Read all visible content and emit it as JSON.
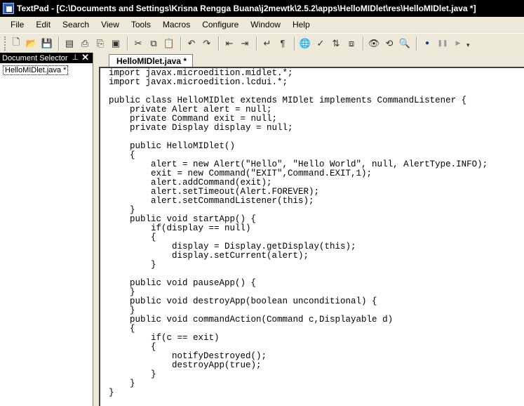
{
  "window": {
    "title": "TextPad - [C:\\Documents and Settings\\Krisna Rengga Buana\\j2mewtk\\2.5.2\\apps\\HelloMIDlet\\res\\HelloMIDlet.java *]"
  },
  "menu": [
    "File",
    "Edit",
    "Search",
    "View",
    "Tools",
    "Macros",
    "Configure",
    "Window",
    "Help"
  ],
  "toolbar": {
    "buttons": [
      {
        "name": "new-file-icon",
        "glyph": "🗋"
      },
      {
        "name": "open-icon",
        "glyph": "📂"
      },
      {
        "name": "save-icon",
        "glyph": "💾"
      },
      {
        "name": "save-all-icon",
        "glyph": "▤"
      },
      {
        "name": "print-icon",
        "glyph": "⎙"
      },
      {
        "name": "print-preview-icon",
        "glyph": "⎘"
      },
      {
        "name": "manage-files-icon",
        "glyph": "▣"
      },
      {
        "name": "cut-icon",
        "glyph": "✂"
      },
      {
        "name": "copy-icon",
        "glyph": "⧉"
      },
      {
        "name": "paste-icon",
        "glyph": "📋"
      },
      {
        "name": "undo-icon",
        "glyph": "↶"
      },
      {
        "name": "redo-icon",
        "glyph": "↷"
      },
      {
        "name": "decrease-indent-icon",
        "glyph": "⇤"
      },
      {
        "name": "increase-indent-icon",
        "glyph": "⇥"
      },
      {
        "name": "word-wrap-icon",
        "glyph": "↵"
      },
      {
        "name": "visible-spaces-icon",
        "glyph": "¶"
      },
      {
        "name": "web-browser-icon",
        "glyph": "🌐"
      },
      {
        "name": "spelling-icon",
        "glyph": "✓"
      },
      {
        "name": "sort-icon",
        "glyph": "⇅"
      },
      {
        "name": "compare-icon",
        "glyph": "⧈"
      },
      {
        "name": "find-icon",
        "glyph": "👁"
      },
      {
        "name": "replace-icon",
        "glyph": "⟲"
      },
      {
        "name": "find-in-files-icon",
        "glyph": "🔍"
      },
      {
        "name": "record-macro-icon",
        "glyph": "●"
      },
      {
        "name": "pause-macro-icon",
        "glyph": "❚❚"
      },
      {
        "name": "play-macro-icon",
        "glyph": "▶"
      }
    ],
    "overflow_glyph": "▾"
  },
  "document_selector": {
    "title": "Document Selector",
    "pin_glyph": "⊥",
    "close_glyph": "✕",
    "items": [
      "HelloMIDlet.java *"
    ]
  },
  "editor": {
    "tab_label": "HelloMIDlet.java *",
    "lines": [
      "import javax.microedition.midlet.*;",
      "import javax.microedition.lcdui.*;",
      "",
      "public class HelloMIDlet extends MIDlet implements CommandListener {",
      "    private Alert alert = null;",
      "    private Command exit = null;",
      "    private Display display = null;",
      "",
      "    public HelloMIDlet()",
      "    {",
      "        alert = new Alert(\"Hello\", \"Hello World\", null, AlertType.INFO);",
      "        exit = new Command(\"EXIT\",Command.EXIT,1);",
      "        alert.addCommand(exit);",
      "        alert.setTimeout(Alert.FOREVER);",
      "        alert.setCommandListener(this);",
      "    }",
      "    public void startApp() {",
      "        if(display == null)",
      "        {",
      "            display = Display.getDisplay(this);",
      "            display.setCurrent(alert);",
      "        }",
      "",
      "    public void pauseApp() {",
      "    }",
      "    public void destroyApp(boolean unconditional) {",
      "    }",
      "    public void commandAction(Command c,Displayable d)",
      "    {",
      "        if(c == exit)",
      "        {",
      "            notifyDestroyed();",
      "            destroyApp(true);",
      "        }",
      "    }",
      "}"
    ]
  }
}
